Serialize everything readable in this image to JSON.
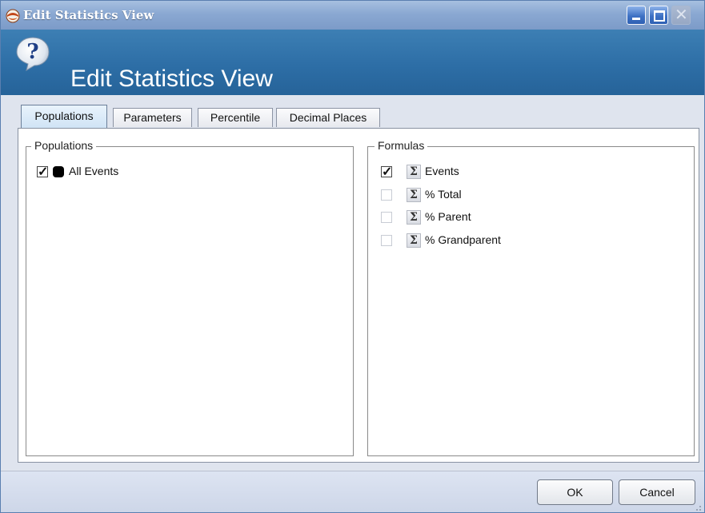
{
  "window": {
    "title": "Edit Statistics View",
    "title_color": "#ffffff",
    "titlebar_color": "#8aa8d2"
  },
  "header": {
    "title": "Edit Statistics View",
    "icon": "help-icon",
    "background": "#2d6ea6"
  },
  "tabs": [
    {
      "label": "Populations",
      "active": true
    },
    {
      "label": "Parameters",
      "active": false
    },
    {
      "label": "Percentile",
      "active": false
    },
    {
      "label": "Decimal Places",
      "active": false
    }
  ],
  "populations": {
    "legend": "Populations",
    "items": [
      {
        "label": "All Events",
        "checked": true,
        "color": "#000000"
      }
    ]
  },
  "formulas": {
    "legend": "Formulas",
    "items": [
      {
        "label": "Events",
        "checked": true,
        "icon": "sigma-icon"
      },
      {
        "label": "% Total",
        "checked": false,
        "icon": "sigma-icon"
      },
      {
        "label": "% Parent",
        "checked": false,
        "icon": "sigma-icon"
      },
      {
        "label": "% Grandparent",
        "checked": false,
        "icon": "sigma-icon"
      }
    ]
  },
  "buttons": {
    "ok": "OK",
    "cancel": "Cancel"
  }
}
